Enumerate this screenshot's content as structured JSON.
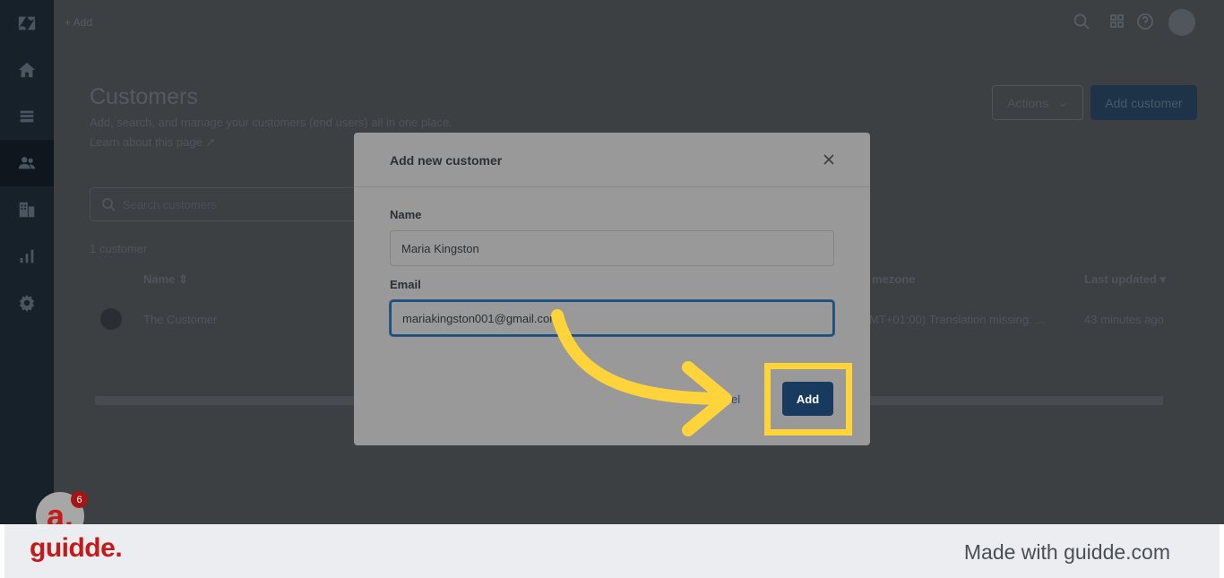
{
  "topbar": {
    "add_label": "+ Add"
  },
  "page": {
    "title": "Customers",
    "subtitle": "Add, search, and manage your customers (end users) all in one place.",
    "learn_link": "Learn about this page ↗",
    "actions_label": "Actions",
    "add_customer_label": "Add customer",
    "search_placeholder": "Search customers",
    "count_text": "1 customer"
  },
  "table": {
    "headers": [
      "Name ⇕",
      "mezone",
      "Last updated ▾"
    ],
    "row": {
      "name": "The Customer",
      "timezone": "MT+01:00) Translation missing: ...",
      "updated": "43 minutes ago"
    }
  },
  "modal": {
    "title": "Add new customer",
    "name_label": "Name",
    "name_value": "Maria Kingston",
    "email_label": "Email",
    "email_value": "mariakingston001@gmail.com",
    "cancel_label": "ancel",
    "add_label": "Add"
  },
  "branding": {
    "logo": "guidde.",
    "made_with": "Made with guidde.com",
    "badge_count": "6",
    "badge_letter": "a."
  },
  "colors": {
    "highlight": "#ffd43b",
    "primary_button": "#173a5e",
    "brand_red": "#c41a1a"
  },
  "icons": [
    "zendesk-logo-icon",
    "home-icon",
    "views-icon",
    "customers-icon",
    "organizations-icon",
    "reporting-icon",
    "settings-icon",
    "search-icon",
    "apps-grid-icon",
    "help-icon",
    "close-icon",
    "chevron-down-icon"
  ]
}
